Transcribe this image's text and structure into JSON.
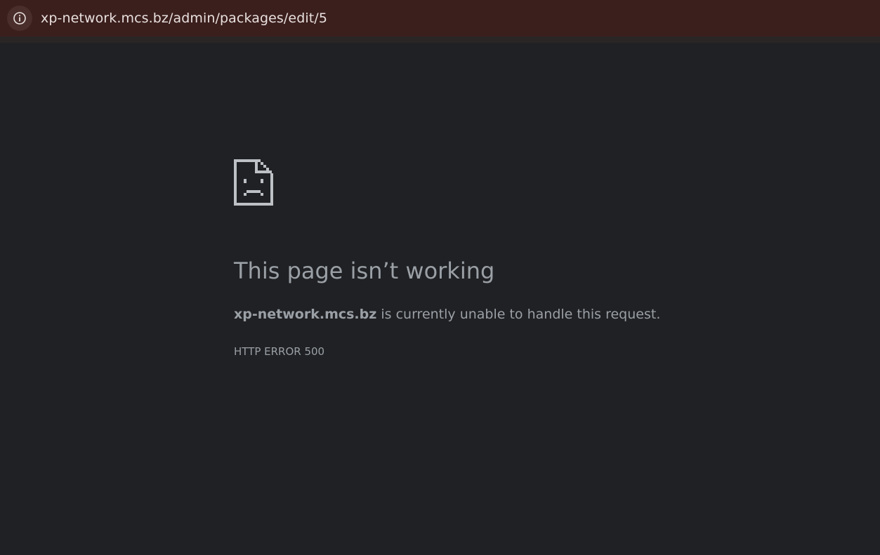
{
  "address_bar": {
    "url": "xp-network.mcs.bz/admin/packages/edit/5",
    "info_icon": "info-icon"
  },
  "error_page": {
    "icon": "sad-page-icon",
    "title": "This page isn’t working",
    "host": "xp-network.mcs.bz",
    "message_suffix": " is currently unable to handle this request.",
    "error_code": "HTTP ERROR 500"
  },
  "colors": {
    "page_background": "#202124",
    "address_bar_background": "#3b1f1d",
    "text": "#9aa0a6"
  }
}
